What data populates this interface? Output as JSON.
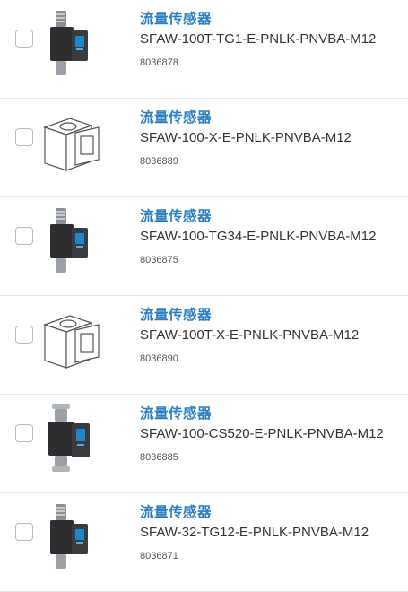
{
  "products": [
    {
      "category": "流量传感器",
      "name": "SFAW-100T-TG1-E-PNLK-PNVBA-M12",
      "part_number": "8036878",
      "image": "dark-sensor"
    },
    {
      "category": "流量传感器",
      "name": "SFAW-100-X-E-PNLK-PNVBA-M12",
      "part_number": "8036889",
      "image": "outline-sensor"
    },
    {
      "category": "流量传感器",
      "name": "SFAW-100-TG34-E-PNLK-PNVBA-M12",
      "part_number": "8036875",
      "image": "dark-sensor"
    },
    {
      "category": "流量传感器",
      "name": "SFAW-100T-X-E-PNLK-PNVBA-M12",
      "part_number": "8036890",
      "image": "outline-sensor"
    },
    {
      "category": "流量传感器",
      "name": "SFAW-100-CS520-E-PNLK-PNVBA-M12",
      "part_number": "8036885",
      "image": "dark-sensor-clamp"
    },
    {
      "category": "流量传感器",
      "name": "SFAW-32-TG12-E-PNLK-PNVBA-M12",
      "part_number": "8036871",
      "image": "dark-sensor"
    }
  ],
  "colors": {
    "category": "#2d7fc1",
    "name": "#333333",
    "part_number": "#555555",
    "divider": "#e6e6e6",
    "checkbox_border": "#b9b9b9"
  }
}
